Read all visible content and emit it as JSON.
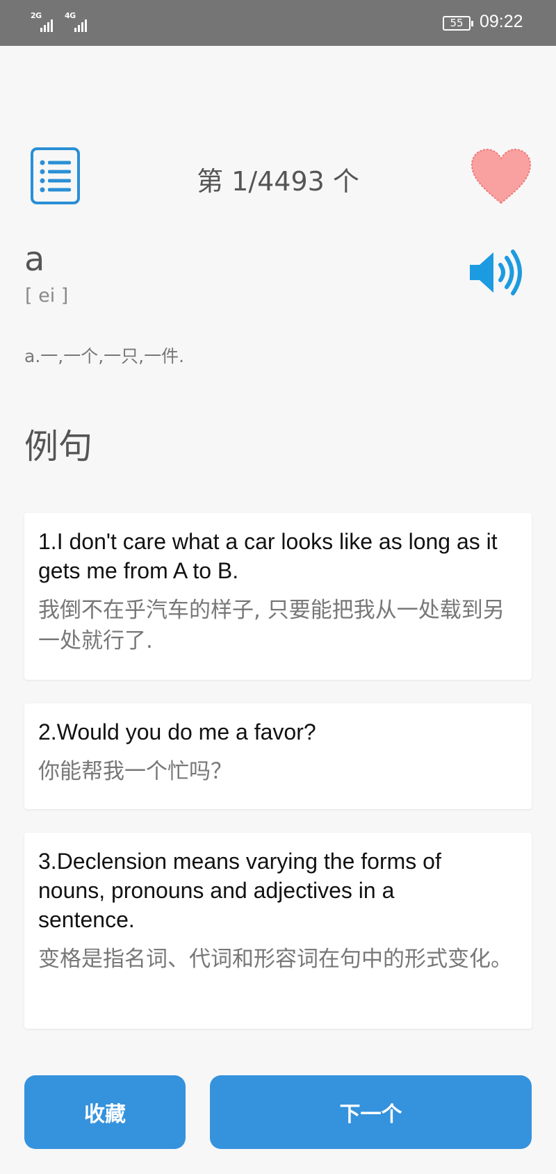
{
  "status_bar": {
    "network_1": "2G",
    "network_2": "4G",
    "battery": "55",
    "time": "09:22"
  },
  "header": {
    "counter": "第 1/4493 个",
    "list_icon": "list-icon",
    "favorite_icon": "heart-icon",
    "accent_color": "#2a8fd6",
    "heart_color": "#f9a0a0"
  },
  "word": {
    "text": "a",
    "phonetic": "[ ei ]",
    "meaning": "a.一,一个,一只,一件.",
    "speaker_icon": "speaker-icon"
  },
  "examples": {
    "title": "例句",
    "items": [
      {
        "en": "1.I don't care what a car looks like as long as it gets me from A to B.",
        "zh": "我倒不在乎汽车的样子, 只要能把我从一处载到另一处就行了."
      },
      {
        "en": "2.Would you do me a favor?",
        "zh": "你能帮我一个忙吗？"
      },
      {
        "en": "3.Declension means varying the forms of nouns, pronouns and adjectives in a sentence.",
        "zh": "变格是指名词、代词和形容词在句中的形式变化。"
      }
    ]
  },
  "actions": {
    "collect_label": "收藏",
    "next_label": "下一个",
    "button_color": "#3592dd"
  }
}
